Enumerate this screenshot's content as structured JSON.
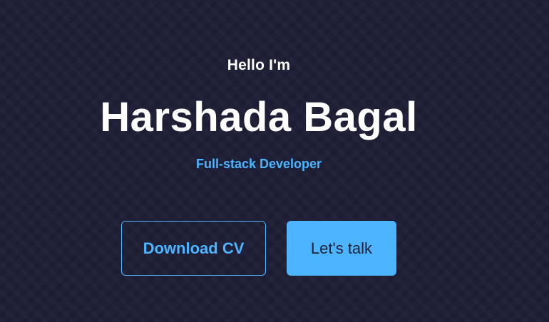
{
  "hero": {
    "greeting": "Hello I'm",
    "name": "Harshada Bagal",
    "role": "Full-stack Developer"
  },
  "actions": {
    "download_cv_label": "Download CV",
    "lets_talk_label": "Let's talk"
  },
  "colors": {
    "background": "#1f1f38",
    "accent": "#4db5ff",
    "text": "#ffffff"
  }
}
